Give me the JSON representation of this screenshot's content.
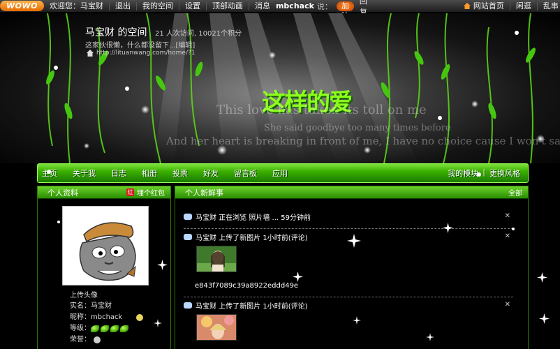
{
  "topbar": {
    "logo": "WOWO",
    "greeting": "欢迎您：马宝财",
    "logout": "退出",
    "my_space": "我的空间",
    "settings": "设置",
    "top_animation": "顶部动画",
    "messages": "消息",
    "user": "mbchack",
    "say": "说：",
    "jiayou": "加油",
    "reply": "回复",
    "site_home": "网站首页",
    "browse": "闲逛",
    "random": "乱串"
  },
  "banner": {
    "title": "马宝财 的空间",
    "stats": "21 人次访问, 10021个积分",
    "desc": "这家伙很懒，什么都没留下...[编辑]",
    "url": "http://lituanwang.com/home/?1",
    "watermark": "这样的爱",
    "lyric_1": "This love has taken its toll on me",
    "lyric_2": "She said goodbye too many times before",
    "lyric_3": "And her heart is breaking in front of me, I have no choice cause I won't say goodbye anymore"
  },
  "nav": {
    "items": [
      "主页",
      "关于我",
      "日志",
      "相册",
      "投票",
      "好友",
      "留言板",
      "应用"
    ],
    "right": [
      "我的模块",
      "|",
      "更换风格"
    ]
  },
  "profile": {
    "header": "个人资料",
    "action": "埋个红包",
    "upload": "上传头像",
    "real_name_label": "实名：",
    "real_name": "马宝财",
    "nickname_label": "昵称：",
    "nickname": "mbchack",
    "level_label": "等级：",
    "honor_label": "荣誉："
  },
  "news": {
    "header": "个人新鲜事",
    "all": "全部",
    "items": [
      {
        "text": "马宝财 正在浏览 照片墙 ... 59分钟前"
      },
      {
        "text": "马宝财 上传了新图片 1小时前(评论)",
        "caption": "e843f7089c39a8922eddd49e"
      },
      {
        "text": "马宝财 上传了新图片 1小时前(评论)"
      }
    ]
  },
  "colors": {
    "accent_green": "#3bb000",
    "jiayou_orange": "#e46b00",
    "background": "#000000"
  }
}
